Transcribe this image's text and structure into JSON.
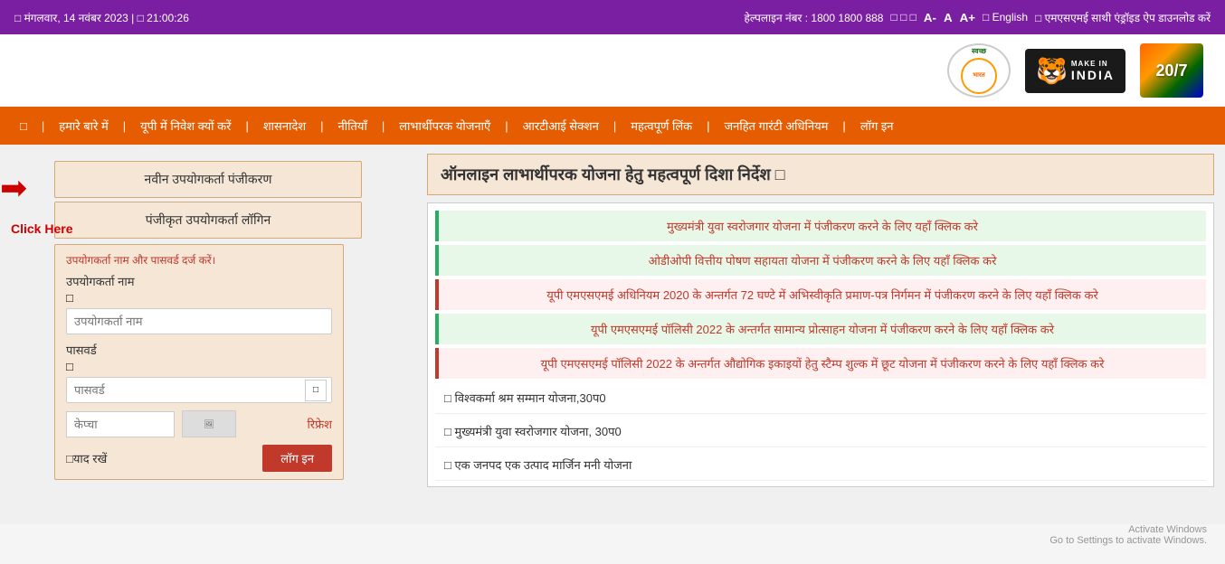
{
  "topbar": {
    "date": "□ मंगलवार, 14 नवंबर 2023 | □ 21:00:26",
    "helpline_label": "हेल्पलाइन नंबर : 1800 1800 888",
    "font_smaller": "A-",
    "font_normal": "A",
    "font_larger": "A+",
    "english_label": "□ English",
    "app_download": "□ एमएसएमई साथी एंड्रॉइड ऐप डाउनलोड करें",
    "separator_chars": "□ □ □"
  },
  "logos": {
    "swachh_bharat": "स्वच्छ भारत",
    "make_in_india": "MAKE IN INDIA",
    "azadi": "20/7"
  },
  "navbar": {
    "items": [
      {
        "id": "home",
        "label": "□"
      },
      {
        "id": "about",
        "label": "हमारे बारे में"
      },
      {
        "id": "invest",
        "label": "यूपी में निवेश क्यों करें"
      },
      {
        "id": "orders",
        "label": "शासनादेश"
      },
      {
        "id": "policies",
        "label": "नीतियाँ"
      },
      {
        "id": "schemes",
        "label": "लाभार्थीपरक योजनाएँ"
      },
      {
        "id": "rti",
        "label": "आरटीआई सेक्शन"
      },
      {
        "id": "links",
        "label": "महत्वपूर्ण लिंक"
      },
      {
        "id": "rti2",
        "label": "जनहित गारंटी अधिनियम"
      },
      {
        "id": "login",
        "label": "लॉग इन"
      }
    ]
  },
  "sidebar": {
    "new_user_btn": "नवीन उपयोगकर्ता पंजीकरण",
    "registered_user_btn": "पंजीकृत उपयोगकर्ता लॉगिन",
    "login_form": {
      "hint": "उपयोगकर्ता नाम और पासवर्ड दर्ज करें।",
      "username_label": "उपयोगकर्ता नाम",
      "username_checkbox": "□",
      "username_placeholder": "उपयोगकर्ता नाम",
      "password_label": "पासवर्ड",
      "password_checkbox": "□",
      "password_placeholder": "पासवर्ड",
      "captcha_placeholder": "केप्चा",
      "refresh_label": "रिफ्रेश",
      "remember_label": "□याद रखें",
      "login_btn": "लॉग इन"
    }
  },
  "annotation": {
    "arrow": "➡",
    "click_here": "Click Here"
  },
  "main": {
    "section_title": "ऑनलाइन लाभार्थीपरक योजना हेतु महत्वपूर्ण दिशा निर्देश □",
    "notices": [
      {
        "text": "मुख्यमंत्री युवा स्वरोजगार योजना में पंजीकरण करने के लिए यहाँ क्लिक करे",
        "type": "green"
      },
      {
        "text": "ओडीओपी वित्तीय पोषण सहायता योजना में पंजीकरण करने के लिए यहाँ क्लिक करे",
        "type": "green"
      },
      {
        "text": "यूपी एमएसएमई अधिनियम 2020 के अन्तर्गत 72 घण्टे में अभिस्वीकृति प्रमाण-पत्र निर्गमन में पंजीकरण करने के लिए यहाँ क्लिक करे",
        "type": "red"
      },
      {
        "text": "यूपी एमएसएमई पॉलिसी 2022 के अन्तर्गत सामान्य प्रोत्साहन योजना में पंजीकरण करने के लिए यहाँ क्लिक करे",
        "type": "green"
      },
      {
        "text": "यूपी एमएसएमई पॉलिसी 2022 के अन्तर्गत औद्योगिक इकाइयों हेतु स्टैम्प शुल्क में छूट योजना में पंजीकरण करने के लिए यहाँ क्लिक करे",
        "type": "red"
      }
    ],
    "scheme_list": [
      {
        "text": "□ विश्वकर्मा श्रम सम्मान योजना,30प0"
      },
      {
        "text": "□ मुख्यमंत्री युवा स्वरोजगार योजना, 30प0"
      },
      {
        "text": "□ एक जनपद एक उत्पाद मार्जिन मनी योजना"
      }
    ]
  },
  "activate_windows": {
    "line1": "Activate Windows",
    "line2": "Go to Settings to activate Windows."
  }
}
